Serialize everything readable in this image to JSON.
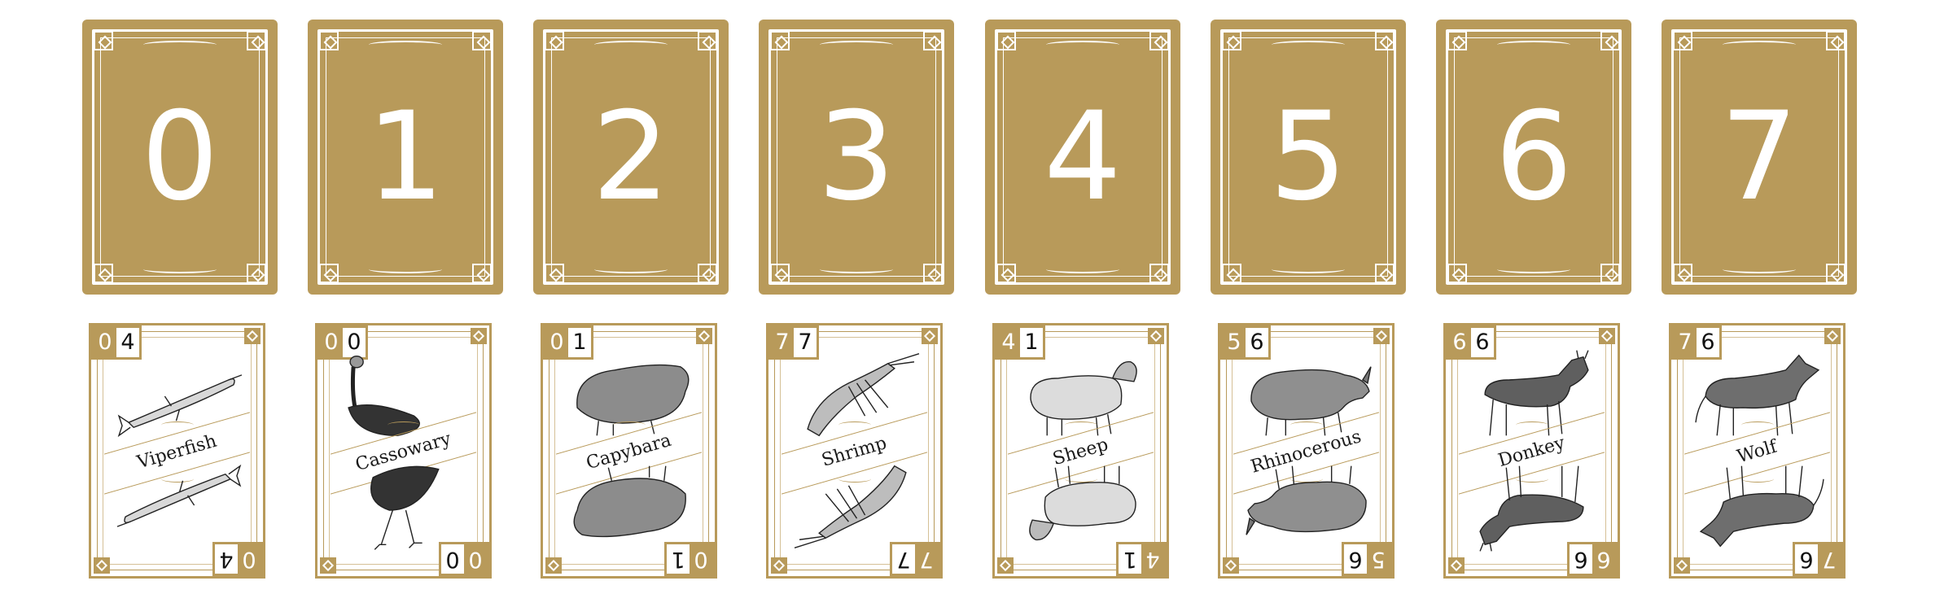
{
  "card_backs": [
    {
      "number": "0"
    },
    {
      "number": "1"
    },
    {
      "number": "2"
    },
    {
      "number": "3"
    },
    {
      "number": "4"
    },
    {
      "number": "5"
    },
    {
      "number": "6"
    },
    {
      "number": "7"
    }
  ],
  "cards": [
    {
      "name": "Viperfish",
      "index_a": "0",
      "index_b": "4",
      "art": "viperfish-icon"
    },
    {
      "name": "Cassowary",
      "index_a": "0",
      "index_b": "0",
      "art": "cassowary-icon"
    },
    {
      "name": "Capybara",
      "index_a": "0",
      "index_b": "1",
      "art": "capybara-icon"
    },
    {
      "name": "Shrimp",
      "index_a": "7",
      "index_b": "7",
      "art": "shrimp-icon"
    },
    {
      "name": "Sheep",
      "index_a": "4",
      "index_b": "1",
      "art": "sheep-icon"
    },
    {
      "name": "Rhinocerous",
      "index_a": "5",
      "index_b": "6",
      "art": "rhinoceros-icon"
    },
    {
      "name": "Donkey",
      "index_a": "6",
      "index_b": "6",
      "art": "donkey-icon"
    },
    {
      "name": "Wolf",
      "index_a": "7",
      "index_b": "6",
      "art": "wolf-icon"
    }
  ],
  "colors": {
    "card_gold": "#b89a5a",
    "ink": "#1a1a1a",
    "background": "#ffffff"
  }
}
